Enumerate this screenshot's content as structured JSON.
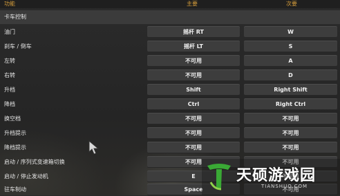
{
  "header": {
    "function_col": "功能",
    "primary_col": "主要",
    "secondary_col": "次要"
  },
  "section": {
    "title": "卡车控制"
  },
  "rows": [
    {
      "label": "油门",
      "primary": "摇杆 RT",
      "secondary": "W"
    },
    {
      "label": "刹车 / 倒车",
      "primary": "摇杆 LT",
      "secondary": "S"
    },
    {
      "label": "左转",
      "primary": "不可用",
      "secondary": "A"
    },
    {
      "label": "右转",
      "primary": "不可用",
      "secondary": "D"
    },
    {
      "label": "升档",
      "primary": "Shift",
      "secondary": "Right Shift"
    },
    {
      "label": "降档",
      "primary": "Ctrl",
      "secondary": "Right Ctrl"
    },
    {
      "label": "换空档",
      "primary": "不可用",
      "secondary": "不可用"
    },
    {
      "label": "升档提示",
      "primary": "不可用",
      "secondary": "不可用"
    },
    {
      "label": "降档提示",
      "primary": "不可用",
      "secondary": "不可用"
    },
    {
      "label": "启动 / 序列式变速箱切换",
      "primary": "不可用",
      "secondary": "不可用"
    },
    {
      "label": "启动 / 停止发动机",
      "primary": "E",
      "secondary": "不可用"
    },
    {
      "label": "驻车制动",
      "primary": "Space",
      "secondary": "不可用"
    }
  ],
  "watermark": {
    "text": "天硕游戏园",
    "subtext": "TIANSHUO.COM",
    "logo_color": "#3aa935"
  },
  "icons": {
    "cursor": "mouse-pointer-icon",
    "logo": "t-logo-icon"
  }
}
